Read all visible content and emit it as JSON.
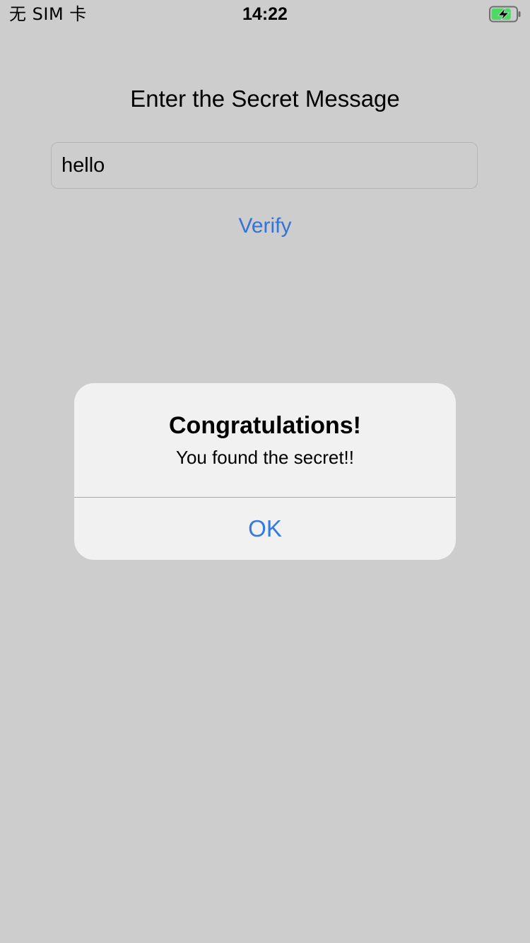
{
  "status_bar": {
    "carrier": "无 SIM 卡",
    "time": "14:22",
    "battery_icon": "battery-charging-icon",
    "battery_color": "#4cd964",
    "battery_level": 0.8
  },
  "main": {
    "title": "Enter the Secret Message",
    "input_value": "hello",
    "verify_label": "Verify"
  },
  "alert": {
    "title": "Congratulations!",
    "message": "You found the secret!!",
    "ok_label": "OK"
  },
  "colors": {
    "background": "#cdcdcd",
    "accent": "#3478e2",
    "alert_background": "#f1f1f1"
  }
}
